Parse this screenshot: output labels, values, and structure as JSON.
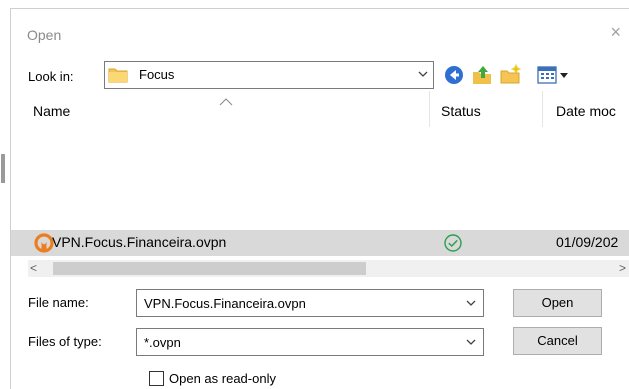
{
  "dialog": {
    "title": "Open",
    "close_glyph": "×"
  },
  "lookin": {
    "label": "Look in:",
    "value": "Focus",
    "folder_icon": "folder-icon"
  },
  "toolbar": {
    "back_icon": "back-icon",
    "up_icon": "up-folder-icon",
    "new_folder_icon": "new-folder-icon",
    "view_icon": "view-menu-icon"
  },
  "list": {
    "columns": {
      "name": "Name",
      "status": "Status",
      "date": "Date moc"
    },
    "files": [
      {
        "name": "VPN.Focus.Financeira.ovpn",
        "status_icon": "synced-check-icon",
        "date": "01/09/202"
      }
    ]
  },
  "scroll": {
    "left": "<",
    "right": ">"
  },
  "filename": {
    "label": "File name:",
    "value": "VPN.Focus.Financeira.ovpn"
  },
  "filetype": {
    "label": "Files of type:",
    "value": "*.ovpn"
  },
  "buttons": {
    "open": "Open",
    "cancel": "Cancel"
  },
  "readonly": {
    "label": "Open as read-only",
    "checked": false
  },
  "colors": {
    "selected_row": "#d9d9d9",
    "button_face": "#e1e1e1",
    "status_green": "#2e9e4f",
    "openvpn_orange": "#ea7e20"
  }
}
